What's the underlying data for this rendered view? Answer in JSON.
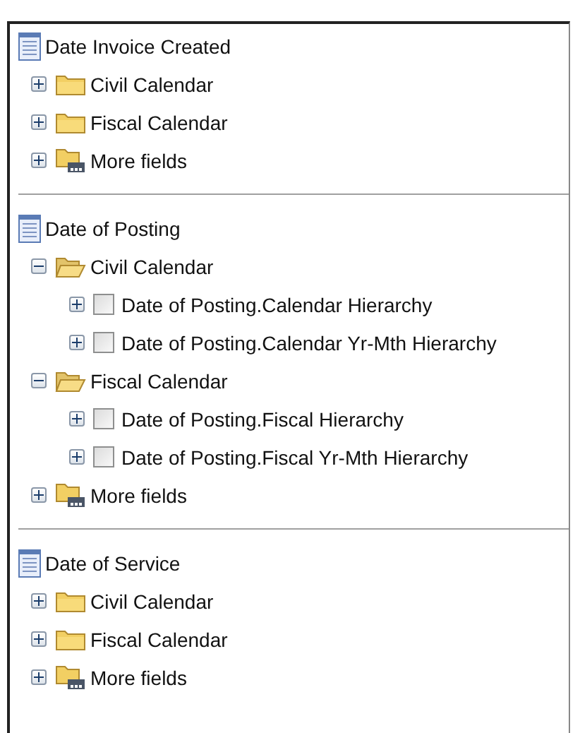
{
  "sections": [
    {
      "title": "Date Invoice Created",
      "items": [
        {
          "kind": "folder",
          "label": "Civil Calendar",
          "expanded": false
        },
        {
          "kind": "folder",
          "label": "Fiscal Calendar",
          "expanded": false
        },
        {
          "kind": "more",
          "label": "More fields",
          "expanded": false
        }
      ]
    },
    {
      "title": "Date of Posting",
      "items": [
        {
          "kind": "folder",
          "label": "Civil Calendar",
          "expanded": true,
          "children": [
            {
              "label": "Date of Posting.Calendar Hierarchy",
              "checked": false
            },
            {
              "label": "Date of Posting.Calendar Yr-Mth Hierarchy",
              "checked": false
            }
          ]
        },
        {
          "kind": "folder",
          "label": "Fiscal Calendar",
          "expanded": true,
          "children": [
            {
              "label": "Date of Posting.Fiscal Hierarchy",
              "checked": false
            },
            {
              "label": "Date of Posting.Fiscal Yr-Mth Hierarchy",
              "checked": false
            }
          ]
        },
        {
          "kind": "more",
          "label": "More fields",
          "expanded": false
        }
      ]
    },
    {
      "title": "Date of Service",
      "items": [
        {
          "kind": "folder",
          "label": "Civil Calendar",
          "expanded": false
        },
        {
          "kind": "folder",
          "label": "Fiscal Calendar",
          "expanded": false
        },
        {
          "kind": "more",
          "label": "More fields",
          "expanded": false
        }
      ]
    }
  ]
}
